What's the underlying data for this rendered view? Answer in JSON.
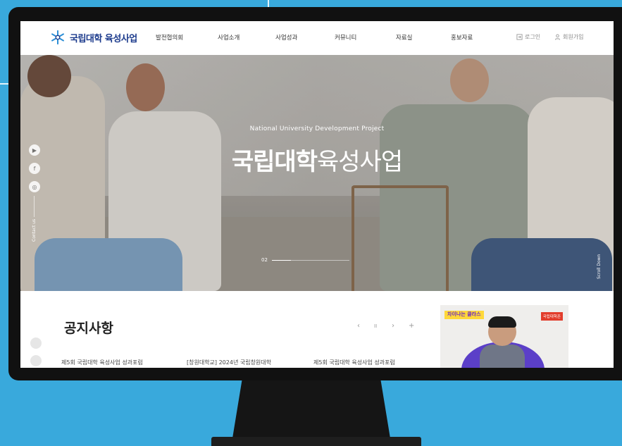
{
  "nav": {
    "logo": "국립대학 육성사업",
    "menu": [
      "발전협의회",
      "사업소개",
      "사업성과",
      "커뮤니티",
      "자료실",
      "홍보자료"
    ],
    "login": "로그인",
    "signup": "회원가입"
  },
  "hero": {
    "subtitle": "National University Development Project",
    "title_bold": "국립대학",
    "title_light": "육성사업",
    "contact_label": "Contact us",
    "scroll_label": "Scroll Down",
    "slide_index": "02",
    "slide_progress": 0.25
  },
  "notice": {
    "title": "공지사항",
    "controls": {
      "prev": "‹",
      "pause": "II",
      "next": "›",
      "more": "+"
    },
    "items": [
      "제5회 국립대학 육성사업 성과포럼",
      "[창원대학교] 2024년 국립창원대학",
      "제5회 국립대학 육성사업 성과포럼"
    ]
  },
  "promo": {
    "badge": "차이나는 클라스",
    "tag": "국립대학존"
  },
  "colors": {
    "brand": "#1b3a8c",
    "background": "#39a9dc",
    "monitor": "#111111"
  },
  "icons": [
    "youtube-icon",
    "facebook-icon",
    "instagram-icon",
    "login-icon",
    "user-icon"
  ]
}
